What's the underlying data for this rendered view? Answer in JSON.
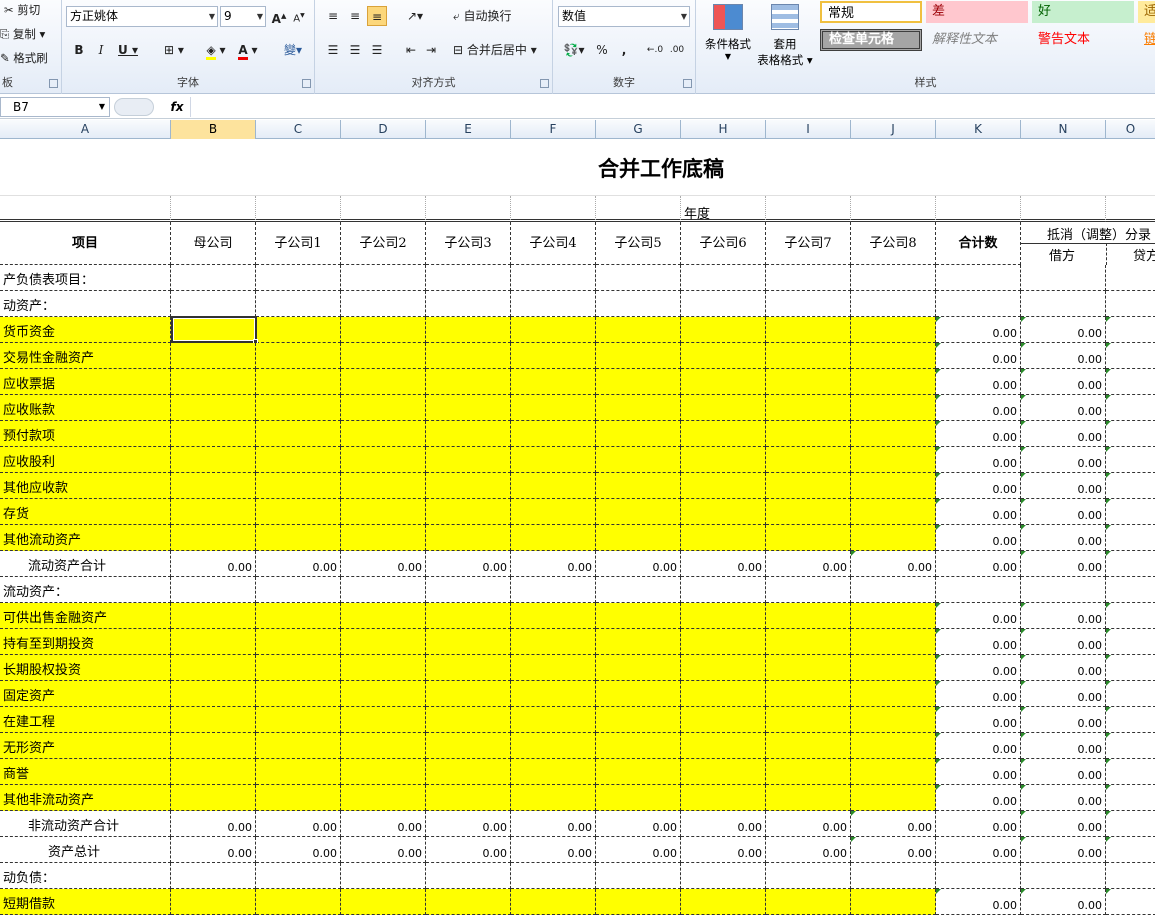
{
  "ribbon": {
    "clipboard": {
      "cut": "剪切",
      "copy": "复制 ▾",
      "format_painter": "格式刷",
      "group": "板"
    },
    "font": {
      "name": "方正姚体",
      "size": "9",
      "group": "字体"
    },
    "alignment": {
      "wrap": "自动换行",
      "merge": "合并后居中 ▾",
      "group": "对齐方式"
    },
    "number": {
      "format": "数值",
      "group": "数字",
      "percent": "%",
      "comma": ","
    },
    "styles": {
      "cond_format": "条件格式",
      "table_format_1": "套用",
      "table_format_2": "表格格式 ▾",
      "normal": "常规",
      "bad": "差",
      "good": "好",
      "neutral": "适",
      "check_cell": "检查单元格",
      "explanatory": "解释性文本",
      "warning": "警告文本",
      "link": "链",
      "group": "样式"
    }
  },
  "formula_bar": {
    "name_box": "B7",
    "fx": "fx",
    "formula": ""
  },
  "columns": [
    "A",
    "B",
    "C",
    "D",
    "E",
    "F",
    "G",
    "H",
    "I",
    "J",
    "K",
    "N",
    "O"
  ],
  "selected_column": "B",
  "sheet": {
    "title": "合并工作底稿",
    "year_label": "年度",
    "headers": {
      "item": "项目",
      "parent": "母公司",
      "subs": [
        "子公司1",
        "子公司2",
        "子公司3",
        "子公司4",
        "子公司5",
        "子公司6",
        "子公司7",
        "子公司8"
      ],
      "total": "合计数",
      "elim": "抵消（调整）分录",
      "debit": "借方",
      "credit": "贷方"
    },
    "zero": "0.00",
    "rows": [
      {
        "label": "产负债表项目：",
        "type": "section"
      },
      {
        "label": "动资产：",
        "type": "section"
      },
      {
        "label": "货币资金",
        "type": "input"
      },
      {
        "label": "交易性金融资产",
        "type": "input"
      },
      {
        "label": "应收票据",
        "type": "input"
      },
      {
        "label": "应收账款",
        "type": "input"
      },
      {
        "label": "预付款项",
        "type": "input"
      },
      {
        "label": "应收股利",
        "type": "input"
      },
      {
        "label": "其他应收款",
        "type": "input"
      },
      {
        "label": "存货",
        "type": "input"
      },
      {
        "label": "其他流动资产",
        "type": "input"
      },
      {
        "label": "流动资产合计",
        "type": "subtotal",
        "indent": 1
      },
      {
        "label": "流动资产：",
        "type": "section"
      },
      {
        "label": "可供出售金融资产",
        "type": "input"
      },
      {
        "label": "持有至到期投资",
        "type": "input"
      },
      {
        "label": "长期股权投资",
        "type": "input"
      },
      {
        "label": "固定资产",
        "type": "input"
      },
      {
        "label": "在建工程",
        "type": "input"
      },
      {
        "label": "无形资产",
        "type": "input"
      },
      {
        "label": "商誉",
        "type": "input"
      },
      {
        "label": "其他非流动资产",
        "type": "input"
      },
      {
        "label": "非流动资产合计",
        "type": "subtotal",
        "indent": 1
      },
      {
        "label": "资产总计",
        "type": "subtotal",
        "indent": 2
      },
      {
        "label": "动负债：",
        "type": "section"
      },
      {
        "label": "短期借款",
        "type": "input"
      }
    ]
  }
}
